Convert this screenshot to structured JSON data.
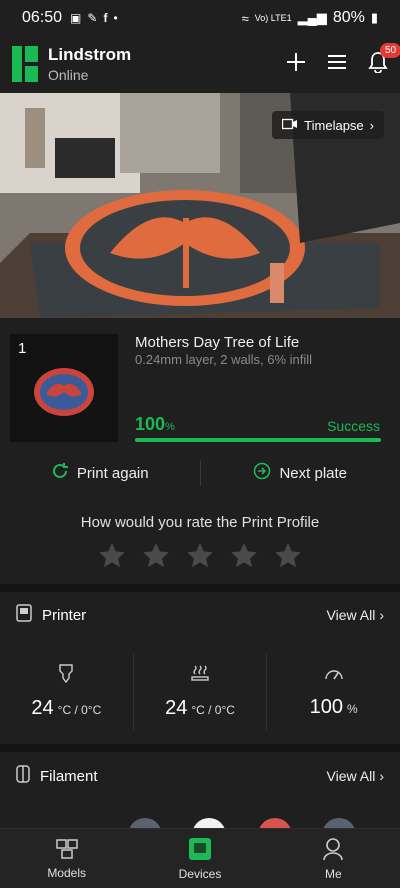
{
  "status_bar": {
    "time": "06:50",
    "network": "Vo) LTE1",
    "battery": "80%"
  },
  "header": {
    "printer_name": "Lindstrom",
    "printer_status": "Online",
    "notification_count": "50"
  },
  "camera": {
    "timelapse_label": "Timelapse"
  },
  "job": {
    "plate_number": "1",
    "title": "Mothers Day Tree of Life",
    "subtitle": "0.24mm layer, 2 walls, 6% infill",
    "progress_value": "100",
    "progress_unit": "%",
    "progress": 1.0,
    "status": "Success"
  },
  "actions": {
    "print_again": "Print again",
    "next_plate": "Next plate"
  },
  "rating": {
    "title": "How would you rate the Print Profile",
    "stars": 5,
    "filled": 0
  },
  "printer_section": {
    "title": "Printer",
    "view_all": "View All",
    "nozzle": {
      "value": "24",
      "unit": "°C / 0°C"
    },
    "bed": {
      "value": "24",
      "unit": "°C / 0°C"
    },
    "fan": {
      "value": "100",
      "unit": "%"
    }
  },
  "filament_section": {
    "title": "Filament",
    "view_all": "View All"
  },
  "bottom_nav": {
    "models": "Models",
    "devices": "Devices",
    "me": "Me"
  },
  "colors": {
    "accent": "#1db954",
    "badge": "#e53935",
    "background": "#1f1f1f"
  }
}
